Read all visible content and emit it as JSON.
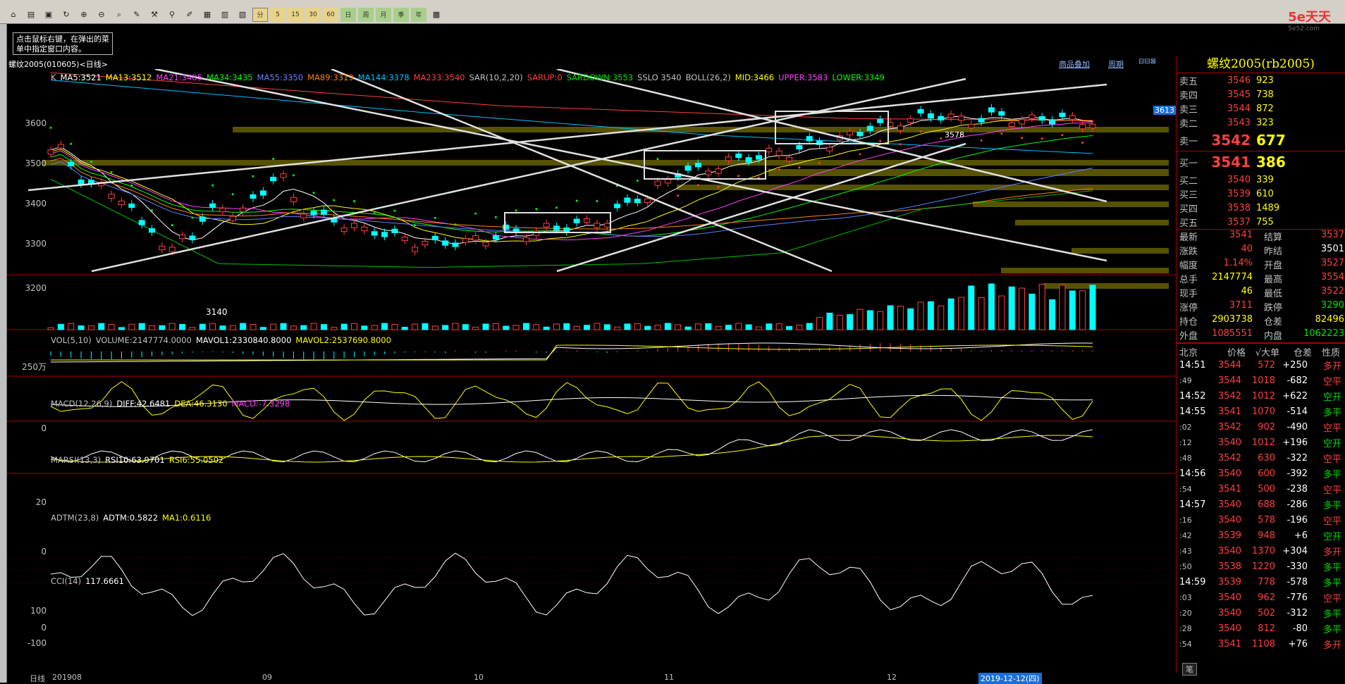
{
  "toolbar": {
    "periods": [
      "分",
      "5",
      "15",
      "30",
      "60",
      "日",
      "周",
      "月",
      "季",
      "年"
    ]
  },
  "logo": {
    "name": "5e天天",
    "sub": "5e52.com"
  },
  "tip": "点击鼠标右键，在弹出的菜单中指定窗口内容。",
  "chart": {
    "header_left": "螺纹2005(010605)<日线>",
    "header_right1": "商品叠加",
    "header_right2": "周期",
    "k_legend": [
      "K",
      "MA5:3521",
      "MA13:3512",
      "MA21:3485",
      "MA34:3435",
      "MA55:3350",
      "MA89:3319",
      "MA144:3378",
      "MA233:3540",
      "SAR(10,2,20)",
      "SARUP:0",
      "SARDOWN:3553",
      "SSLO 3540",
      "BOLL(26,2)",
      "MID:3466",
      "UPPER:3583",
      "LOWER:3349"
    ],
    "price_labels": [
      "3600",
      "3500",
      "3400",
      "3300",
      "3200"
    ],
    "low_label": "3140",
    "high_label": "3578",
    "price_tag": "3613",
    "vol_legend": [
      "VOL(5,10)",
      "VOLUME:2147774.0000",
      "MAVOL1:2330840.8000",
      "MAVOL2:2537690.8000"
    ],
    "vol_axis": "250万",
    "macd_legend": [
      "MACD(12,26,9)",
      "DIFF:42.6481",
      "DEA:46.3130",
      "MACD:-7.3298"
    ],
    "macd_axis": "0",
    "rsi_legend": [
      "MARSI(13,3)",
      "RSI10:63.9701",
      "RSI6:55.0502"
    ],
    "rsi_axis": "20",
    "adtm_legend": [
      "ADTM(23,8)",
      "ADTM:0.5822",
      "MA1:0.6116"
    ],
    "adtm_axis": "0",
    "cci_legend": [
      "CCI(14)",
      "117.6661"
    ],
    "cci_axis": [
      "100",
      "0",
      "-100"
    ],
    "x_axis": {
      "start": "日线",
      "labels": [
        "201908",
        "09",
        "10",
        "11",
        "12"
      ],
      "cursor": "2019-12-12(四)"
    }
  },
  "quote": {
    "title": "螺纹2005(rb2005)",
    "asks": [
      {
        "l": "卖五",
        "p": "3546",
        "v": "923"
      },
      {
        "l": "卖四",
        "p": "3545",
        "v": "738"
      },
      {
        "l": "卖三",
        "p": "3544",
        "v": "872"
      },
      {
        "l": "卖二",
        "p": "3543",
        "v": "323"
      },
      {
        "l": "卖一",
        "p": "3542",
        "v": "677"
      }
    ],
    "bids": [
      {
        "l": "买一",
        "p": "3541",
        "v": "386"
      },
      {
        "l": "买二",
        "p": "3540",
        "v": "339"
      },
      {
        "l": "买三",
        "p": "3539",
        "v": "610"
      },
      {
        "l": "买四",
        "p": "3538",
        "v": "1489"
      },
      {
        "l": "买五",
        "p": "3537",
        "v": "755"
      }
    ],
    "stats": [
      {
        "l1": "最新",
        "v1": "3541",
        "c1": "#ff4040",
        "l2": "结算",
        "v2": "3537",
        "c2": "#ff4040"
      },
      {
        "l1": "涨跌",
        "v1": "40",
        "c1": "#ff4040",
        "l2": "昨结",
        "v2": "3501",
        "c2": "#fff"
      },
      {
        "l1": "幅度",
        "v1": "1.14%",
        "c1": "#ff4040",
        "l2": "开盘",
        "v2": "3527",
        "c2": "#ff4040"
      },
      {
        "l1": "总手",
        "v1": "2147774",
        "c1": "#ffff00",
        "l2": "最高",
        "v2": "3554",
        "c2": "#ff4040"
      },
      {
        "l1": "现手",
        "v1": "46",
        "c1": "#ffff00",
        "l2": "最低",
        "v2": "3522",
        "c2": "#ff4040"
      },
      {
        "l1": "涨停",
        "v1": "3711",
        "c1": "#ff4040",
        "l2": "跌停",
        "v2": "3290",
        "c2": "#00e000"
      },
      {
        "l1": "持仓",
        "v1": "2903738",
        "c1": "#ffff00",
        "l2": "仓差",
        "v2": "82496",
        "c2": "#ffff00"
      },
      {
        "l1": "外盘",
        "v1": "1085551",
        "c1": "#ff4040",
        "l2": "内盘",
        "v2": "1062223",
        "c2": "#00e000"
      }
    ],
    "tick_header": [
      "北京",
      "价格",
      "√大单",
      "仓差",
      "性质"
    ],
    "ticks": [
      {
        "t": "14:51",
        "p": "3544",
        "v": "572",
        "d": "+250",
        "k": "多开",
        "dc": "#fff",
        "kc": "#ff4040"
      },
      {
        "t": ":49",
        "p": "3544",
        "v": "1018",
        "d": "-682",
        "k": "空平",
        "dc": "#fff",
        "kc": "#ff4040"
      },
      {
        "t": "14:52",
        "p": "3542",
        "v": "1012",
        "d": "+622",
        "k": "空开",
        "dc": "#fff",
        "kc": "#00e000"
      },
      {
        "t": "14:55",
        "p": "3541",
        "v": "1070",
        "d": "-514",
        "k": "多平",
        "dc": "#fff",
        "kc": "#00e000"
      },
      {
        "t": ":02",
        "p": "3542",
        "v": "902",
        "d": "-490",
        "k": "空平",
        "dc": "#fff",
        "kc": "#ff4040"
      },
      {
        "t": ":12",
        "p": "3540",
        "v": "1012",
        "d": "+196",
        "k": "空开",
        "dc": "#fff",
        "kc": "#00e000"
      },
      {
        "t": ":48",
        "p": "3542",
        "v": "630",
        "d": "-322",
        "k": "空平",
        "dc": "#fff",
        "kc": "#ff4040"
      },
      {
        "t": "14:56",
        "p": "3540",
        "v": "600",
        "d": "-392",
        "k": "多平",
        "dc": "#fff",
        "kc": "#00e000"
      },
      {
        "t": ":54",
        "p": "3541",
        "v": "500",
        "d": "-238",
        "k": "空平",
        "dc": "#fff",
        "kc": "#ff4040"
      },
      {
        "t": "14:57",
        "p": "3540",
        "v": "688",
        "d": "-286",
        "k": "多平",
        "dc": "#fff",
        "kc": "#00e000"
      },
      {
        "t": ":16",
        "p": "3540",
        "v": "578",
        "d": "-196",
        "k": "空平",
        "dc": "#fff",
        "kc": "#ff4040"
      },
      {
        "t": ":42",
        "p": "3539",
        "v": "948",
        "d": "+6",
        "k": "空开",
        "dc": "#fff",
        "kc": "#00e000"
      },
      {
        "t": ":43",
        "p": "3540",
        "v": "1370",
        "d": "+304",
        "k": "多开",
        "dc": "#fff",
        "kc": "#ff4040"
      },
      {
        "t": ":50",
        "p": "3538",
        "v": "1220",
        "d": "-330",
        "k": "多平",
        "dc": "#fff",
        "kc": "#00e000"
      },
      {
        "t": "14:59",
        "p": "3539",
        "v": "778",
        "d": "-578",
        "k": "多平",
        "dc": "#fff",
        "kc": "#00e000"
      },
      {
        "t": ":03",
        "p": "3540",
        "v": "962",
        "d": "-776",
        "k": "空平",
        "dc": "#fff",
        "kc": "#ff4040"
      },
      {
        "t": ":20",
        "p": "3540",
        "v": "502",
        "d": "-312",
        "k": "多平",
        "dc": "#fff",
        "kc": "#00e000"
      },
      {
        "t": ":28",
        "p": "3540",
        "v": "812",
        "d": "-80",
        "k": "多平",
        "dc": "#fff",
        "kc": "#00e000"
      },
      {
        "t": ":54",
        "p": "3541",
        "v": "1108",
        "d": "+76",
        "k": "多开",
        "dc": "#fff",
        "kc": "#ff4040"
      }
    ],
    "bottom_tab": "笔"
  }
}
